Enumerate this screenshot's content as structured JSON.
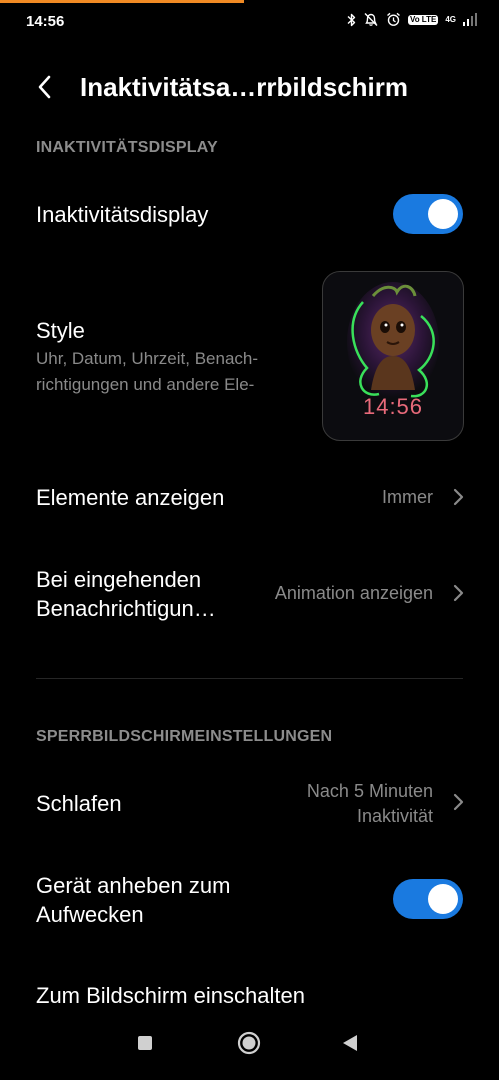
{
  "status_bar": {
    "time": "14:56",
    "volte_label": "Vo LTE",
    "network_label": "4G",
    "icons": [
      "bluetooth-icon",
      "notifications-off-icon",
      "alarm-icon",
      "volte-icon",
      "signal-icon"
    ]
  },
  "header": {
    "back_icon": "chevron-left-icon",
    "title": "Inaktivitätsa…rrbildschirm"
  },
  "section_inactivity": {
    "label": "INAKTIVITÄTSDISPLAY",
    "display_toggle": {
      "label": "Inaktivitätsdisplay",
      "state": "on"
    },
    "style": {
      "title": "Style",
      "subtitle_line1": "Uhr, Datum, Uhrzeit, Benach-",
      "subtitle_line2": "richtigungen und andere Ele-",
      "preview_time": "14:56"
    },
    "show_elements": {
      "label": "Elemente anzeigen",
      "value": "Immer"
    },
    "incoming": {
      "label_line1": "Bei eingehenden",
      "label_line2": "Benachrichtigun…",
      "value": "Animation anzeigen"
    }
  },
  "section_lock": {
    "label": "SPERRBILDSCHIRMEINSTELLUNGEN",
    "sleep": {
      "label": "Schlafen",
      "value_line1": "Nach 5 Minuten",
      "value_line2": "Inaktivität"
    },
    "raise_to_wake": {
      "label_line1": "Gerät anheben zum",
      "label_line2": "Aufwecken",
      "state": "on"
    },
    "screen_on": {
      "label": "Zum Bildschirm einschalten"
    }
  },
  "colors": {
    "background": "#000000",
    "accent": "#1a7ae0",
    "secondary_text": "#8a8a8a",
    "progress": "#f08a24"
  },
  "nav_bar": {
    "icons": [
      "recents-square-icon",
      "home-circle-icon",
      "back-triangle-icon"
    ]
  }
}
